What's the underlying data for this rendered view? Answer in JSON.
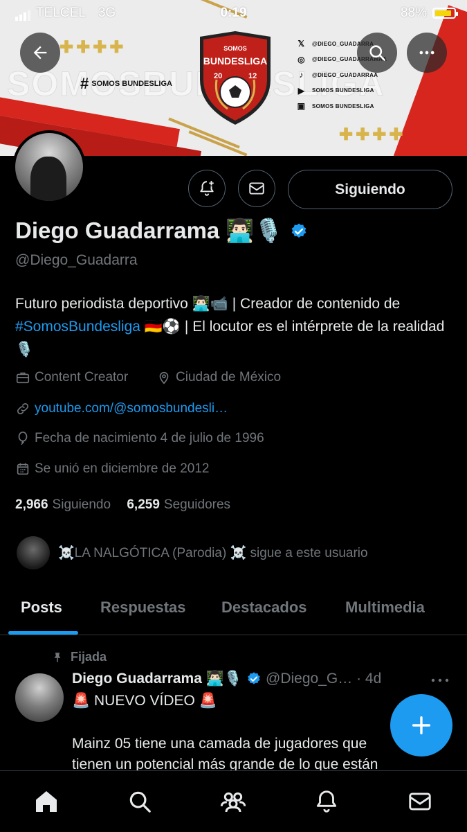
{
  "status_bar": {
    "carrier": "TELCEL",
    "network": "3G",
    "time": "0:19",
    "battery": "88%",
    "battery_level": 0.88
  },
  "banner": {
    "watermark": "SOMOSBUNDESLIGA",
    "hashtag_label": "SOMOS BUNDESLIGA",
    "logo_top": "SOMOS",
    "logo_main": "BUNDESLIGA",
    "logo_year_left": "20",
    "logo_year_right": "12",
    "crosses": "✚✚✚✚",
    "socials": [
      {
        "icon": "x-logo-icon",
        "glyph": "𝕏",
        "text": "@DIEGO_GUADARRA"
      },
      {
        "icon": "instagram-icon",
        "glyph": "◎",
        "text": "@DIEGO_GUADARRAMAA"
      },
      {
        "icon": "tiktok-icon",
        "glyph": "♪",
        "text": "@DIEGO_GUADARRAA"
      },
      {
        "icon": "youtube-icon",
        "glyph": "▶",
        "text": "SOMOS BUNDESLIGA"
      },
      {
        "icon": "twitch-icon",
        "glyph": "▣",
        "text": "SOMOS BUNDESLIGA"
      }
    ]
  },
  "profile": {
    "name": "Diego Guadarrama 👨🏻‍💻🎙️",
    "handle": "@Diego_Guadarra",
    "follow_button": "Siguiendo",
    "bio_1": "Futuro periodista deportivo 👨🏻‍💻📹 | Creador de contenido de ",
    "bio_hashtag": "#SomosBundesliga",
    "bio_2": " 🇩🇪⚽ | El locutor es el intérprete de la realidad 🎙️",
    "category": "Content Creator",
    "location": "Ciudad de México",
    "website": "youtube.com/@somosbundesli…",
    "birthday": "Fecha de nacimiento 4 de julio de 1996",
    "joined": "Se unió en diciembre de 2012",
    "following_count": "2,966",
    "following_label": "Siguiendo",
    "followers_count": "6,259",
    "followers_label": "Seguidores",
    "followed_by": "☠️LA NALGÓTICA (Parodia) ☠️ sigue a este usuario"
  },
  "tabs": [
    {
      "label": "Posts",
      "active": true
    },
    {
      "label": "Respuestas",
      "active": false
    },
    {
      "label": "Destacados",
      "active": false
    },
    {
      "label": "Multimedia",
      "active": false
    }
  ],
  "post": {
    "pinned_label": "Fijada",
    "author": "Diego Guadarrama 👨🏻‍💻🎙️",
    "handle_time": "@Diego_G… · 4d",
    "line1": "🚨 NUEVO VÍDEO 🚨",
    "line2": "Mainz 05 tiene una camada de jugadores que",
    "line3": "tienen un potencial más grande de lo que están"
  },
  "colors": {
    "accent": "#1d9bf0",
    "background": "#000000",
    "secondary_text": "#71767b",
    "banner_red": "#d7261e",
    "banner_gold": "#c9a24a"
  }
}
